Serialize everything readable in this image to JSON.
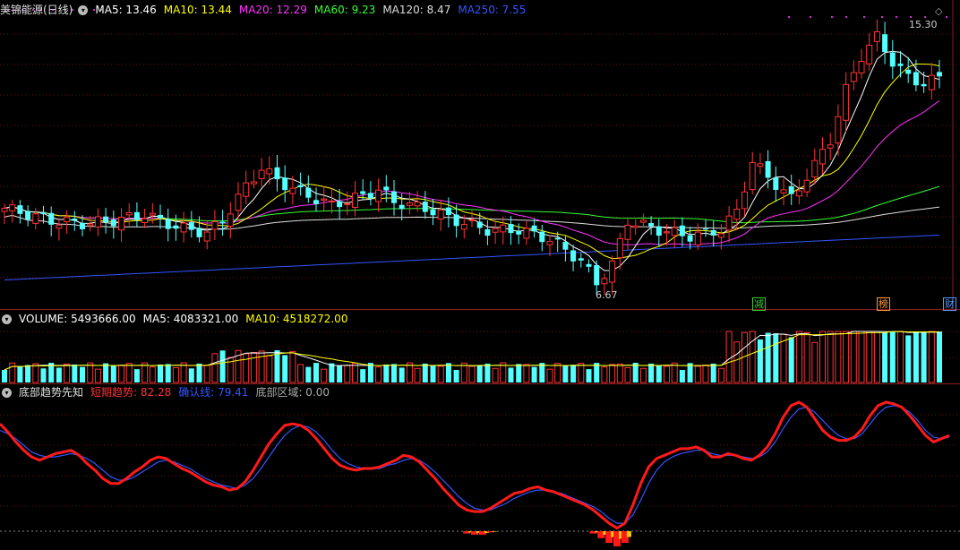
{
  "stock": {
    "name": "美锦能源(日线)"
  },
  "main_legend": [
    {
      "label": "MA5: 13.46",
      "color": "#ffffff"
    },
    {
      "label": "MA10: 13.44",
      "color": "#ffff00"
    },
    {
      "label": "MA20: 12.29",
      "color": "#ff33ff"
    },
    {
      "label": "MA60: 9.23",
      "color": "#33ff33"
    },
    {
      "label": "MA120: 8.47",
      "color": "#dddddd"
    },
    {
      "label": "MA250: 7.55",
      "color": "#3355ff"
    }
  ],
  "price_annotations": {
    "high": "15.30",
    "low": "6.67"
  },
  "event_tags": [
    {
      "text": "减",
      "color": "#33cc33"
    },
    {
      "text": "榜",
      "color": "#ff9933"
    },
    {
      "text": "财",
      "color": "#5599ff"
    }
  ],
  "volume_legend": [
    {
      "label": "VOLUME: 5493666.00",
      "color": "#ffffff"
    },
    {
      "label": "MA5: 4083321.00",
      "color": "#ffffff"
    },
    {
      "label": "MA10: 4518272.00",
      "color": "#ffff00"
    }
  ],
  "indicator": {
    "name": "底部趋势先知",
    "legend": [
      {
        "label": "短期趋势: 82.28",
        "color": "#ff3333"
      },
      {
        "label": "确认线: 79.41",
        "color": "#3355ff"
      },
      {
        "label": "底部区域: 0.00",
        "color": "#aaaaaa"
      }
    ]
  },
  "chart_data": {
    "type": "line",
    "short_trend_series": [
      74,
      69,
      63,
      58,
      54,
      52,
      54,
      56,
      57,
      58,
      55,
      50,
      46,
      41,
      38,
      38,
      41,
      45,
      48,
      52,
      54,
      53,
      50,
      47,
      45,
      42,
      39,
      37,
      36,
      34,
      35,
      39,
      46,
      54,
      62,
      68,
      73,
      74,
      73,
      70,
      65,
      59,
      53,
      49,
      47,
      46,
      47,
      47,
      48,
      50,
      52,
      55,
      54,
      51,
      46,
      41,
      35,
      30,
      25,
      22,
      21,
      21,
      23,
      26,
      29,
      32,
      33,
      35,
      36,
      34,
      33,
      31,
      29,
      27,
      25,
      22,
      18,
      14,
      11,
      14,
      25,
      38,
      48,
      53,
      55,
      57,
      59,
      59,
      60,
      58,
      54,
      54,
      56,
      55,
      53,
      52,
      55,
      60,
      68,
      78,
      85,
      87,
      84,
      77,
      70,
      66,
      64,
      64,
      66,
      71,
      79,
      85,
      87,
      86,
      84,
      79,
      73,
      67,
      63,
      65,
      67
    ],
    "confirm_line_series": [
      70,
      68,
      65,
      61,
      57,
      55,
      54,
      54,
      55,
      56,
      55,
      53,
      50,
      46,
      42,
      40,
      40,
      42,
      45,
      48,
      51,
      52,
      51,
      49,
      47,
      44,
      41,
      39,
      37,
      36,
      35,
      37,
      41,
      47,
      54,
      61,
      67,
      71,
      73,
      72,
      69,
      64,
      58,
      53,
      50,
      48,
      47,
      47,
      47,
      49,
      50,
      52,
      53,
      52,
      49,
      45,
      40,
      35,
      30,
      26,
      23,
      22,
      22,
      24,
      26,
      29,
      31,
      33,
      34,
      34,
      33,
      32,
      30,
      28,
      26,
      24,
      21,
      17,
      14,
      14,
      19,
      28,
      38,
      46,
      51,
      54,
      56,
      57,
      58,
      58,
      56,
      55,
      55,
      55,
      54,
      53,
      54,
      57,
      63,
      71,
      78,
      83,
      84,
      81,
      76,
      71,
      67,
      65,
      65,
      68,
      74,
      80,
      84,
      85,
      84,
      81,
      76,
      70,
      66,
      65,
      66
    ]
  }
}
